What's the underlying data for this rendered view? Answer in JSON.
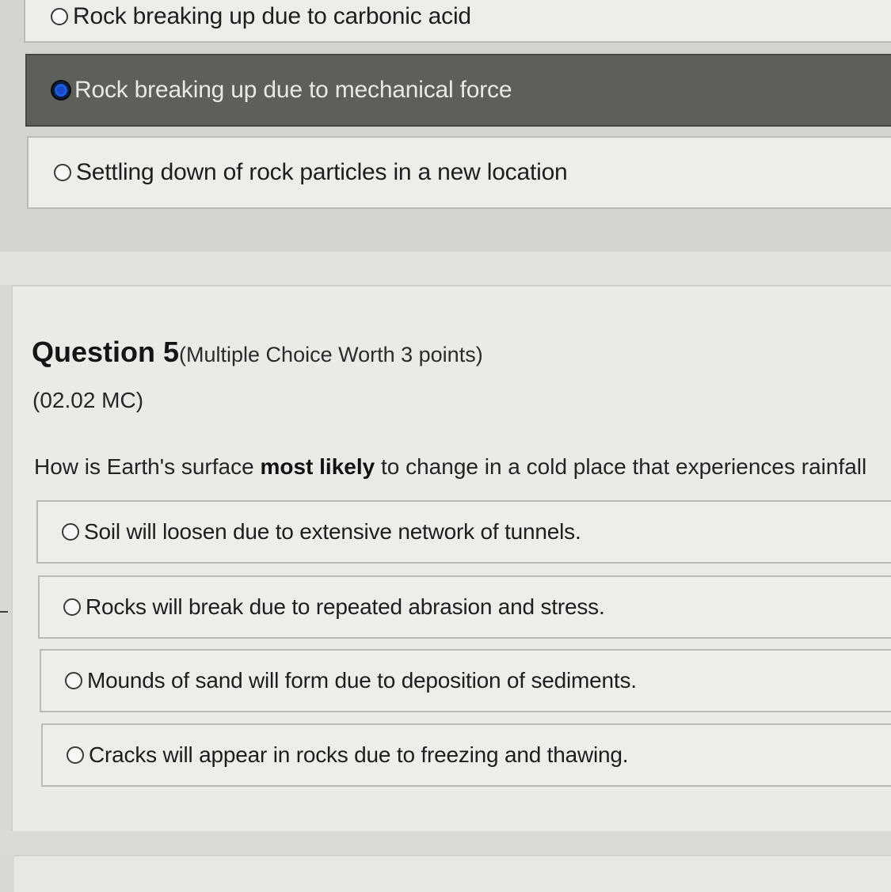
{
  "previous_question": {
    "options": [
      {
        "label": "Rock breaking up due to carbonic acid",
        "selected": false
      },
      {
        "label": "Rock breaking up due to mechanical force",
        "selected": true
      },
      {
        "label": "Settling down of rock particles in a new location",
        "selected": false
      }
    ]
  },
  "question": {
    "title": "Question 5",
    "meta": "(Multiple Choice Worth 3 points)",
    "code": "(02.02 MC)",
    "prompt_before": "How is Earth's surface ",
    "prompt_bold": "most likely",
    "prompt_after": " to change in a cold place that experiences rainfall",
    "options": [
      {
        "label": "Soil will loosen due to extensive network of tunnels.",
        "selected": false
      },
      {
        "label": "Rocks will break due to repeated abrasion and stress.",
        "selected": false
      },
      {
        "label": "Mounds of sand will form due to deposition of sediments.",
        "selected": false
      },
      {
        "label": "Cracks will appear in rocks due to freezing and thawing.",
        "selected": false
      }
    ]
  },
  "colors": {
    "selected_option_bg": "#5d5f5b",
    "radio_checked": "#1a5ee0",
    "page_bg": "#d7dad4",
    "card_bg": "#e9ebe7"
  }
}
